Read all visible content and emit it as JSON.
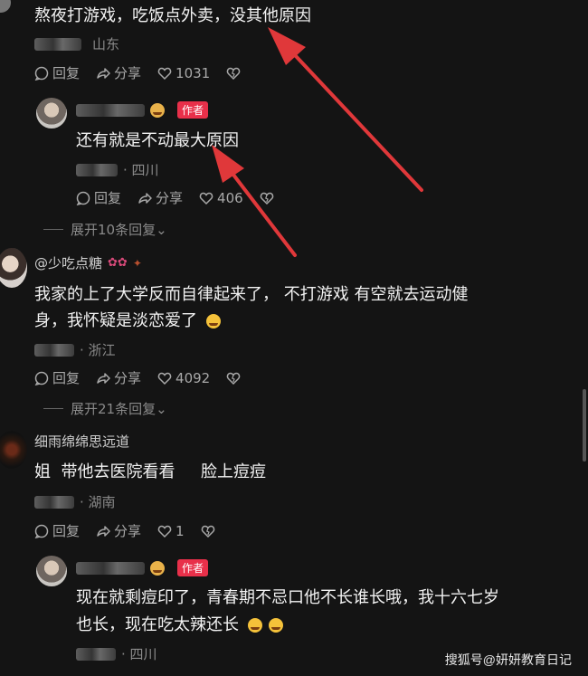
{
  "comments": [
    {
      "text": "熬夜打游戏，吃饭点外卖，没其他原因",
      "location": "山东",
      "actions": {
        "reply": "回复",
        "share": "分享",
        "likes": "1031"
      }
    },
    {
      "badge": "作者",
      "text": "还有就是不动最大原因",
      "location": "· 四川",
      "actions": {
        "reply": "回复",
        "share": "分享",
        "likes": "406"
      }
    },
    {
      "expand": "展开10条回复"
    },
    {
      "username": "@少吃点糖",
      "text_line1": "我家的上了大学反而自律起来了， 不打游戏 有空就去运动健",
      "text_line2": "身，我怀疑是淡恋爱了",
      "location": "· 浙江",
      "actions": {
        "reply": "回复",
        "share": "分享",
        "likes": "4092"
      },
      "expand": "展开21条回复"
    },
    {
      "username": "细雨绵绵思远道",
      "text": "姐  带他去医院看看     脸上痘痘",
      "location": "· 湖南",
      "actions": {
        "reply": "回复",
        "share": "分享",
        "likes": "1"
      }
    },
    {
      "badge": "作者",
      "text_line1": "现在就剩痘印了，青春期不忌口他不长谁长哦，我十六七岁",
      "text_line2": "也长，现在吃太辣还长",
      "location": "· 四川"
    }
  ],
  "watermark": "搜狐号@妍妍教育日记",
  "colors": {
    "background": "#141414",
    "badge": "#e8304a",
    "arrow": "#e0383a"
  }
}
